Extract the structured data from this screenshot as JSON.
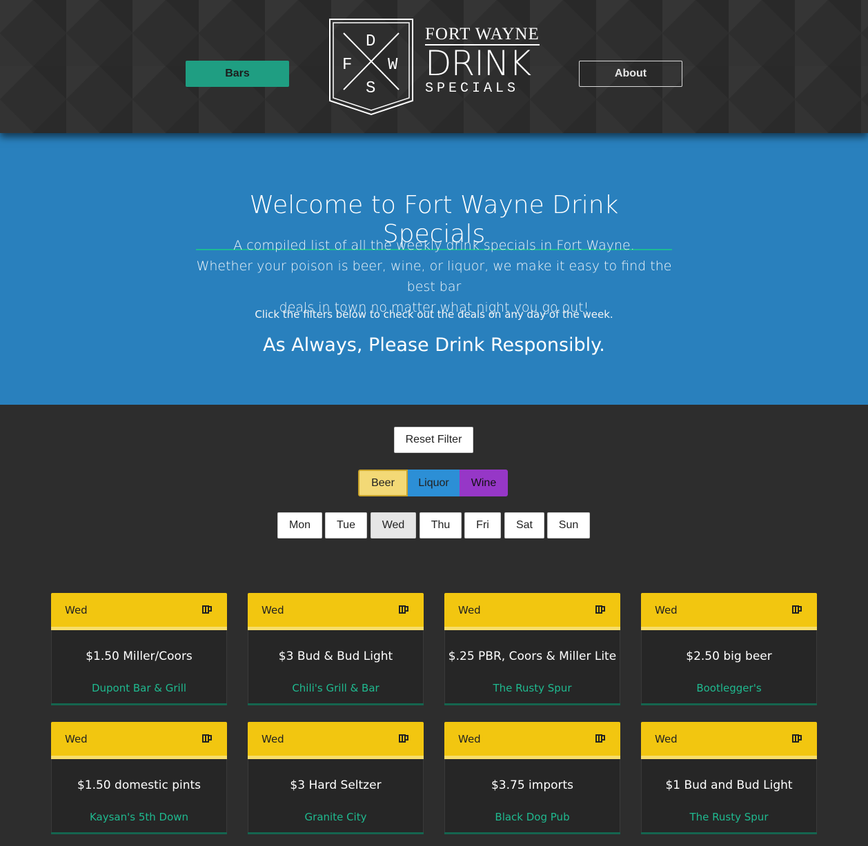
{
  "header": {
    "bars_label": "Bars",
    "about_label": "About",
    "logo": {
      "letters": [
        "D",
        "F",
        "W",
        "S"
      ],
      "line1": "FORT WAYNE",
      "line2": "DRINK",
      "line3": "SPECIALS"
    }
  },
  "hero": {
    "title": "Welcome to Fort Wayne Drink Specials",
    "line1": "A compiled list of all the weekly drink specials in Fort Wayne.",
    "line2": "Whether your poison is beer, wine, or liquor, we make it easy to find the best bar",
    "line3": "deals in town no matter what night you go out!",
    "click_note": "Click the filters below to check out the deals on any day of the week.",
    "responsibly": "As Always, Please Drink Responsibly."
  },
  "filters": {
    "reset_label": "Reset Filter",
    "types": [
      {
        "label": "Beer",
        "color": "#f3d976",
        "active": true
      },
      {
        "label": "Liquor",
        "color": "#2c8fd6",
        "active": false
      },
      {
        "label": "Wine",
        "color": "#9637c7",
        "active": false
      }
    ],
    "days": [
      {
        "label": "Mon",
        "active": false
      },
      {
        "label": "Tue",
        "active": false
      },
      {
        "label": "Wed",
        "active": true
      },
      {
        "label": "Thu",
        "active": false
      },
      {
        "label": "Fri",
        "active": false
      },
      {
        "label": "Sat",
        "active": false
      },
      {
        "label": "Sun",
        "active": false
      }
    ]
  },
  "specials": [
    {
      "day": "Wed",
      "icon": "beer-mug-icon",
      "deal": "$1.50 Miller/Coors",
      "bar": "Dupont Bar & Grill"
    },
    {
      "day": "Wed",
      "icon": "beer-mug-icon",
      "deal": "$3 Bud & Bud Light",
      "bar": "Chili's Grill & Bar"
    },
    {
      "day": "Wed",
      "icon": "beer-mug-icon",
      "deal": "$.25 PBR, Coors & Miller Lite",
      "bar": "The Rusty Spur"
    },
    {
      "day": "Wed",
      "icon": "beer-mug-icon",
      "deal": "$2.50 big beer",
      "bar": "Bootlegger's"
    },
    {
      "day": "Wed",
      "icon": "beer-mug-icon",
      "deal": "$1.50 domestic pints",
      "bar": "Kaysan's 5th Down"
    },
    {
      "day": "Wed",
      "icon": "beer-mug-icon",
      "deal": "$3 Hard Seltzer",
      "bar": "Granite City"
    },
    {
      "day": "Wed",
      "icon": "beer-mug-icon",
      "deal": "$3.75 imports",
      "bar": "Black Dog Pub"
    },
    {
      "day": "Wed",
      "icon": "beer-mug-icon",
      "deal": "$1 Bud and Bud Light",
      "bar": "The Rusty Spur"
    }
  ],
  "colors": {
    "accent_green": "#1f9e82",
    "hero_blue": "#2980bd",
    "card_yellow": "#f2c610",
    "bar_link": "#1fb98f"
  }
}
